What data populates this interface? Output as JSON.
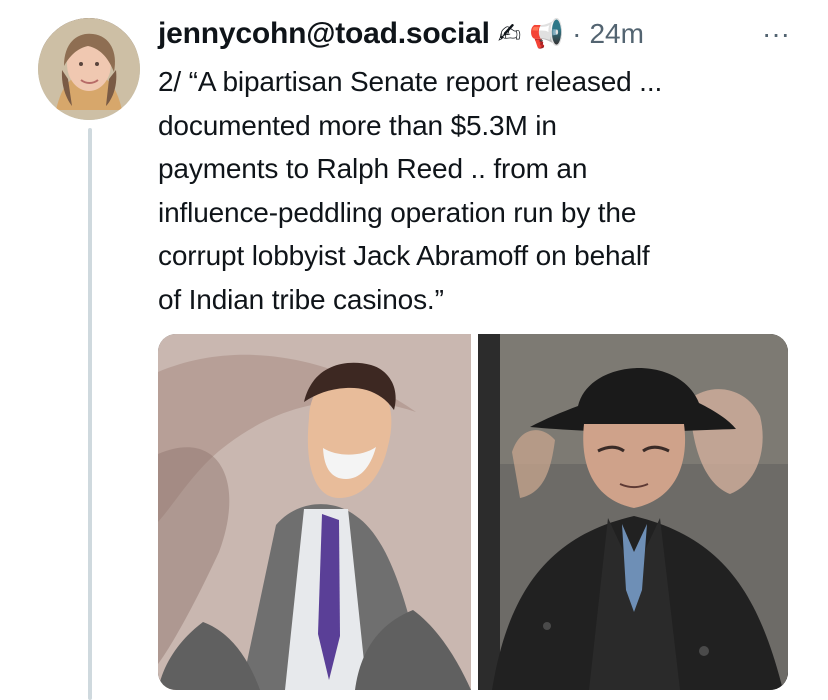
{
  "post": {
    "author_handle": "jennycohn@toad.social",
    "author_badges": [
      "writing-hand-icon",
      "megaphone-icon"
    ],
    "separator": "·",
    "timestamp": "24m",
    "more_label": "···",
    "text_lines": [
      "2/ “A bipartisan Senate report released ...",
      "documented more than $5.3M in",
      "payments to Ralph Reed .. from an",
      "influence-peddling operation run by the",
      "corrupt lobbyist Jack Abramoff on behalf",
      "of Indian tribe casinos.”"
    ],
    "media": {
      "count": 2
    }
  },
  "colors": {
    "text": "#0f1419",
    "secondary_text": "#536471",
    "thread_line": "#cfd9de",
    "background": "#ffffff"
  }
}
